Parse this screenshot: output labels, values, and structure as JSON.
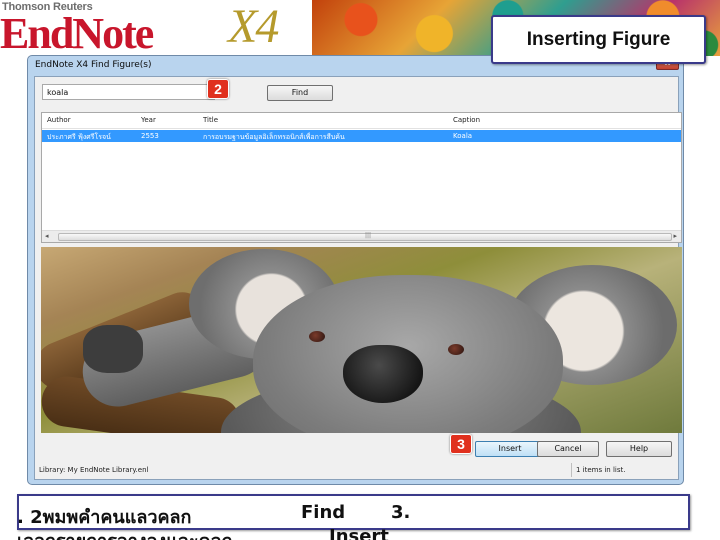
{
  "banner": {
    "company": "Thomson Reuters",
    "product": "EndNote",
    "version": "X4",
    "slide_title": "Inserting Figure"
  },
  "dialog": {
    "title": "EndNote X4 Find Figure(s)",
    "close_label": "x",
    "search": {
      "value": "koala",
      "placeholder": ""
    },
    "find_label": "Find",
    "columns": [
      "Author",
      "Year",
      "Title",
      "Caption"
    ],
    "rows": [
      {
        "author": "ประภาศรี ฟุ้งศรีโรจน์",
        "year": "2553",
        "title": "การอบรมฐานข้อมูลอิเล็กทรอนิกส์เพื่อการสืบค้น",
        "caption": "Koala"
      }
    ],
    "scrollbar": {
      "left": "◂",
      "right": "▸",
      "grip": "|||"
    },
    "insert_label": "Insert",
    "cancel_label": "Cancel",
    "help_label": "Help",
    "library_label": "Library: My EndNote Library.enl",
    "count_label": "1 items in list.",
    "preview_alt": "koala-photo"
  },
  "markers": {
    "step2": "2",
    "step3": "3"
  },
  "caption": {
    "line1": ". 2พมพคำคนแลวคลก",
    "find": "Find",
    "step3": "3.",
    "line2": "เลอกรายการอางองและคลก",
    "insert": "Insert"
  },
  "colors": {
    "accent_red": "#e0301e",
    "selection_blue": "#3399ff",
    "dialog_frame": "#b9d4ee",
    "box_border": "#3a3a8a"
  }
}
